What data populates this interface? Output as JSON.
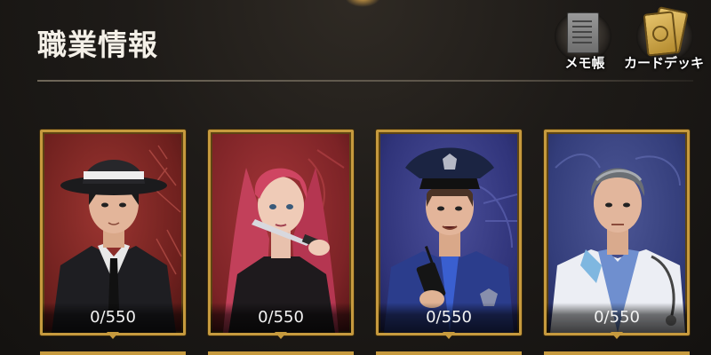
{
  "header": {
    "title": "職業情報"
  },
  "toolbar": {
    "memo_label": "メモ帳",
    "deck_label": "カードデッキ"
  },
  "cards": [
    {
      "name": "mafia",
      "count": "0/550",
      "bg": "#7a2422"
    },
    {
      "name": "assassin",
      "count": "0/550",
      "bg": "#7c2326"
    },
    {
      "name": "police",
      "count": "0/550",
      "bg": "#30347a"
    },
    {
      "name": "doctor",
      "count": "0/550",
      "bg": "#333d7a"
    }
  ],
  "colors": {
    "frame_gold": "#c69a3e",
    "background": "#1e1b18"
  }
}
